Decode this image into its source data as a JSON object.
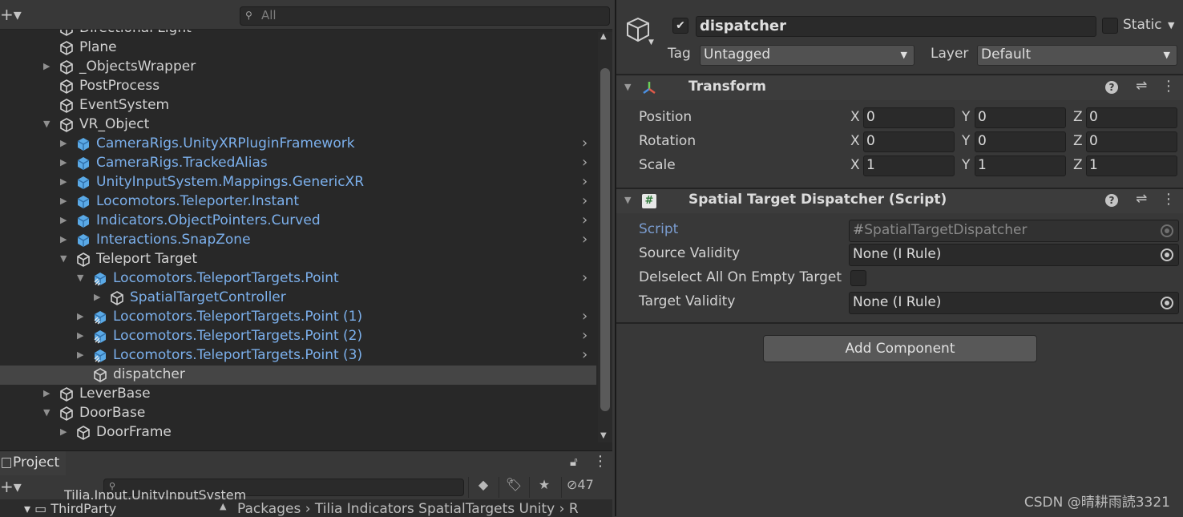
{
  "hierarchy": {
    "search_placeholder": "All",
    "rows": [
      {
        "label": "Directional Light",
        "color": "white",
        "indent": 0,
        "expand": "none",
        "icon": "cube-outline",
        "chevron": false,
        "selected": false
      },
      {
        "label": "Plane",
        "color": "white",
        "indent": 0,
        "expand": "none",
        "icon": "cube-outline",
        "chevron": false,
        "selected": false
      },
      {
        "label": "_ObjectsWrapper",
        "color": "white",
        "indent": 0,
        "expand": "collapsed",
        "icon": "cube-outline",
        "chevron": false,
        "selected": false
      },
      {
        "label": "PostProcess",
        "color": "white",
        "indent": 0,
        "expand": "none",
        "icon": "cube-outline",
        "chevron": false,
        "selected": false
      },
      {
        "label": "EventSystem",
        "color": "white",
        "indent": 0,
        "expand": "none",
        "icon": "cube-outline",
        "chevron": false,
        "selected": false
      },
      {
        "label": "VR_Object",
        "color": "white",
        "indent": 0,
        "expand": "expanded",
        "icon": "cube-outline",
        "chevron": false,
        "selected": false
      },
      {
        "label": "CameraRigs.UnityXRPluginFramework",
        "color": "blue",
        "indent": 1,
        "expand": "collapsed",
        "icon": "prefab",
        "chevron": true,
        "selected": false
      },
      {
        "label": "CameraRigs.TrackedAlias",
        "color": "blue",
        "indent": 1,
        "expand": "collapsed",
        "icon": "prefab",
        "chevron": true,
        "selected": false
      },
      {
        "label": "UnityInputSystem.Mappings.GenericXR",
        "color": "blue",
        "indent": 1,
        "expand": "collapsed",
        "icon": "prefab",
        "chevron": true,
        "selected": false
      },
      {
        "label": "Locomotors.Teleporter.Instant",
        "color": "blue",
        "indent": 1,
        "expand": "collapsed",
        "icon": "prefab",
        "chevron": true,
        "selected": false
      },
      {
        "label": "Indicators.ObjectPointers.Curved",
        "color": "blue",
        "indent": 1,
        "expand": "collapsed",
        "icon": "prefab",
        "chevron": true,
        "selected": false
      },
      {
        "label": "Interactions.SnapZone",
        "color": "blue",
        "indent": 1,
        "expand": "collapsed",
        "icon": "prefab",
        "chevron": true,
        "selected": false
      },
      {
        "label": "Teleport Target",
        "color": "white",
        "indent": 1,
        "expand": "expanded",
        "icon": "cube-outline",
        "chevron": false,
        "selected": false
      },
      {
        "label": "Locomotors.TeleportTargets.Point",
        "color": "blue",
        "indent": 2,
        "expand": "expanded",
        "icon": "prefab-variant",
        "chevron": true,
        "selected": false
      },
      {
        "label": "SpatialTargetController",
        "color": "blue",
        "indent": 3,
        "expand": "collapsed",
        "icon": "cube-outline",
        "chevron": false,
        "selected": false
      },
      {
        "label": "Locomotors.TeleportTargets.Point (1)",
        "color": "blue",
        "indent": 2,
        "expand": "collapsed",
        "icon": "prefab-variant",
        "chevron": true,
        "selected": false
      },
      {
        "label": "Locomotors.TeleportTargets.Point (2)",
        "color": "blue",
        "indent": 2,
        "expand": "collapsed",
        "icon": "prefab-variant",
        "chevron": true,
        "selected": false
      },
      {
        "label": "Locomotors.TeleportTargets.Point (3)",
        "color": "blue",
        "indent": 2,
        "expand": "collapsed",
        "icon": "prefab-variant",
        "chevron": true,
        "selected": false
      },
      {
        "label": "dispatcher",
        "color": "white",
        "indent": 2,
        "expand": "none",
        "icon": "cube-outline",
        "chevron": false,
        "selected": true
      },
      {
        "label": "LeverBase",
        "color": "white",
        "indent": 0,
        "expand": "collapsed",
        "icon": "cube-outline",
        "chevron": false,
        "selected": false
      },
      {
        "label": "DoorBase",
        "color": "white",
        "indent": 0,
        "expand": "expanded",
        "icon": "cube-outline",
        "chevron": false,
        "selected": false
      },
      {
        "label": "DoorFrame",
        "color": "white",
        "indent": 1,
        "expand": "collapsed",
        "icon": "cube-outline",
        "chevron": false,
        "selected": false
      }
    ]
  },
  "project": {
    "tab_label": "Project",
    "hidden_count": "47",
    "peek_item": "Tilia.Input.UnityInputSystem",
    "tree_item": "ThirdParty",
    "breadcrumb": "Packages  ›  Tilia Indicators SpatialTargets Unity  ›  R"
  },
  "inspector": {
    "object_name": "dispatcher",
    "active": true,
    "static_label": "Static",
    "tag_label": "Tag",
    "tag_value": "Untagged",
    "layer_label": "Layer",
    "layer_value": "Default",
    "transform": {
      "title": "Transform",
      "rows": [
        {
          "label": "Position",
          "x": "0",
          "y": "0",
          "z": "0"
        },
        {
          "label": "Rotation",
          "x": "0",
          "y": "0",
          "z": "0"
        },
        {
          "label": "Scale",
          "x": "1",
          "y": "1",
          "z": "1"
        }
      ],
      "axes": [
        "X",
        "Y",
        "Z"
      ]
    },
    "script_component": {
      "title": "Spatial Target Dispatcher (Script)",
      "script_label": "Script",
      "script_value": "SpatialTargetDispatcher",
      "source_validity_label": "Source Validity",
      "source_validity_value": "None (I Rule)",
      "deselect_label": "Delselect All On Empty Target",
      "target_validity_label": "Target Validity",
      "target_validity_value": "None (I Rule)"
    },
    "add_component_label": "Add Component"
  },
  "watermark": "CSDN @晴耕雨読3321",
  "colors": {
    "prefab_blue": "#7cb0ec",
    "text": "#d2d2d2",
    "panel": "#383838",
    "hierarchy_bg": "#282828",
    "selection": "#454545"
  }
}
